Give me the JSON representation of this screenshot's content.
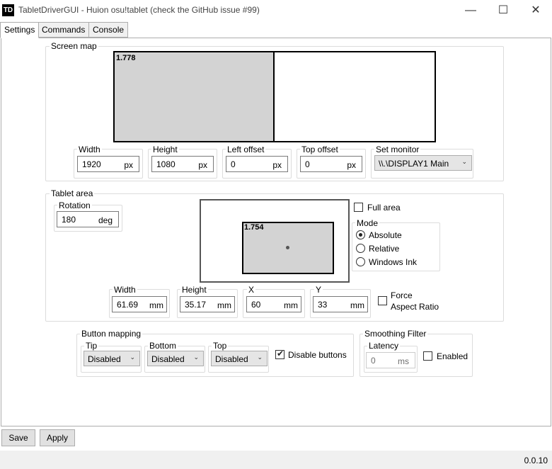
{
  "window": {
    "icon_text": "TD",
    "title": "TabletDriverGUI - Huion osu!tablet (check the GitHub issue #99)",
    "minimize": "—",
    "maximize": "☐",
    "close": "✕"
  },
  "tabs": [
    {
      "label": "Settings"
    },
    {
      "label": "Commands"
    },
    {
      "label": "Console"
    }
  ],
  "screen_map": {
    "title": "Screen map",
    "ratio": "1.778",
    "width_label": "Width",
    "width": "1920",
    "width_unit": "px",
    "height_label": "Height",
    "height": "1080",
    "height_unit": "px",
    "left_label": "Left offset",
    "left": "0",
    "left_unit": "px",
    "top_label": "Top offset",
    "top": "0",
    "top_unit": "px",
    "monitor_label": "Set monitor",
    "monitor": "\\\\.\\DISPLAY1 Main"
  },
  "tablet_area": {
    "title": "Tablet area",
    "rotation_label": "Rotation",
    "rotation": "180",
    "rotation_unit": "deg",
    "ratio": "1.754",
    "full_area": "Full area",
    "mode_label": "Mode",
    "modes": [
      {
        "label": "Absolute",
        "selected": true
      },
      {
        "label": "Relative",
        "selected": false
      },
      {
        "label": "Windows Ink",
        "selected": false
      }
    ],
    "width_label": "Width",
    "width": "61.69",
    "width_unit": "mm",
    "height_label": "Height",
    "height": "35.17",
    "height_unit": "mm",
    "x_label": "X",
    "x": "60",
    "x_unit": "mm",
    "y_label": "Y",
    "y": "33",
    "y_unit": "mm",
    "force_aspect_1": "Force",
    "force_aspect_2": "Aspect Ratio"
  },
  "button_mapping": {
    "title": "Button mapping",
    "tip_label": "Tip",
    "tip": "Disabled",
    "bottom_label": "Bottom",
    "bottom": "Disabled",
    "top_label": "Top",
    "top": "Disabled",
    "disable_buttons": "Disable buttons",
    "disable_buttons_checked": true
  },
  "smoothing": {
    "title": "Smoothing Filter",
    "latency_label": "Latency",
    "latency": "0",
    "latency_unit": "ms",
    "enabled": "Enabled"
  },
  "actions": {
    "save": "Save",
    "apply": "Apply"
  },
  "status": {
    "version": "0.0.10"
  }
}
